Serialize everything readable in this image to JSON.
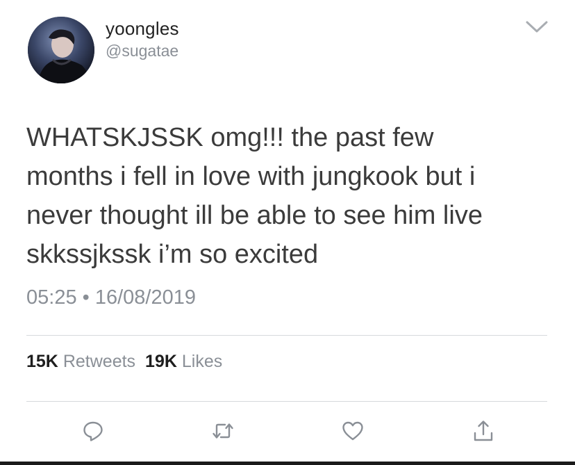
{
  "user": {
    "display_name": "yoongles",
    "handle": "@sugatae",
    "avatar_icon": "profile-photo"
  },
  "tweet": {
    "text": "WHATSKJSSK omg!!! the past few\nmonths i fell in love with jungkook but i\nnever thought ill be able to see him live\nskkssjkssk i’m so excited",
    "time": "05:25",
    "separator": "•",
    "date": "16/08/2019"
  },
  "stats": {
    "retweets_count": "15K",
    "retweets_label": "Retweets",
    "likes_count": "19K",
    "likes_label": "Likes"
  },
  "actions": [
    {
      "icon": "reply-icon"
    },
    {
      "icon": "retweet-icon"
    },
    {
      "icon": "like-icon"
    },
    {
      "icon": "share-icon"
    }
  ],
  "colors": {
    "text": "#3b3b3b",
    "secondary": "#8a8f96",
    "divider": "#d6d9dc"
  }
}
